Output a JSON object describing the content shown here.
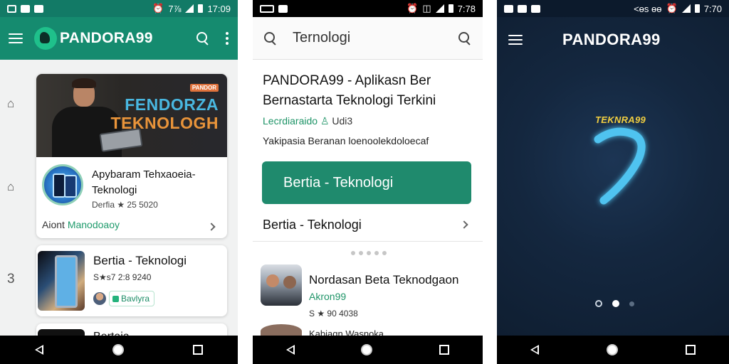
{
  "phone1": {
    "status_time": "17:09",
    "status_signal": "7⅞",
    "brand": "PANDORA99",
    "rail": [
      "⌂",
      "⌂",
      "3"
    ],
    "hero": {
      "badge": "PANDOR",
      "line1": "FENDORZA",
      "line2": "TEKNOLOGH"
    },
    "card1": {
      "title": "Apybaram Tehxaoeia-Teknologi",
      "meta": "Derfia ★ 25 5020",
      "footer_prefix": "Aiont",
      "footer_link": "Manodoaoy"
    },
    "card2": {
      "title": "Bertia - Teknologi",
      "meta": "S★s7 2:8 9240",
      "chip": "Bavlyra"
    },
    "card3": {
      "title": "Bertaia"
    }
  },
  "phone2": {
    "status_time": "7:78",
    "search_query": "Ternologi",
    "title": "PANDORA99 - Aplikasn Ber Bernastarta Teknologi Terkini",
    "developer": "Lecrdiaraido",
    "developer_suffix": "Udi3",
    "description": "Yakipasia Beranan loenoolekdoloecaf",
    "primary_button": "Bertia - Teknologi",
    "section_label": "Bertia - Teknologi",
    "item": {
      "title": "Nordasan Beta Teknodgaon",
      "developer": "Akron99",
      "meta": "S ★ 90 4038"
    },
    "next_item_title": "Kabiagn Wasnoka"
  },
  "phone3": {
    "status_time": "7:70",
    "status_prefix": "<ɵs ɵɵ",
    "brand": "PANDORA99",
    "logo_tag": "TEKNRA99",
    "page_indicator": {
      "count": 3,
      "active": 2
    }
  },
  "colors": {
    "primary_green": "#158b6f",
    "button_green": "#1f8a6d",
    "link_green": "#1e9467",
    "dark_navy": "#112238",
    "logo_blue": "#4fc3f0",
    "logo_gold": "#f2cf41"
  }
}
